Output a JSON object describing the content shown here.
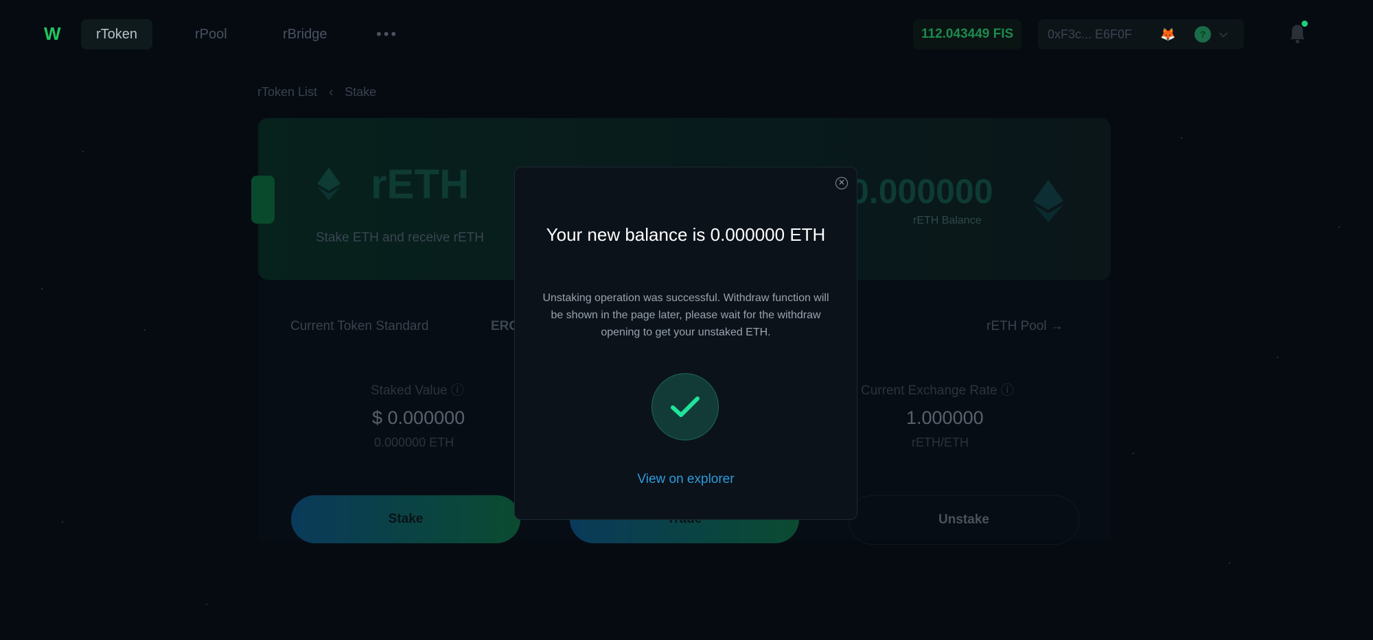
{
  "nav": {
    "tabs": [
      {
        "label": "rToken"
      },
      {
        "label": "rPool"
      },
      {
        "label": "rBridge"
      }
    ],
    "more": "•••",
    "fis_balance": "112.043449 FIS",
    "address": "0xF3c... E6F0F"
  },
  "page": {
    "breadcrumb": {
      "root": "rToken List",
      "sep": "‹",
      "current": "Stake"
    },
    "hero": {
      "title": "rETH",
      "subtitle": "Stake ETH and receive rETH",
      "balance": "0.000000",
      "balance_label": "rETH Balance"
    },
    "token_standard_label": "Current Token Standard",
    "token_standard_value": "ERC",
    "pool_link": "rETH Pool",
    "stats": {
      "staked_label": "Staked Value",
      "staked_value": "$ 0.000000",
      "staked_sub": "0.000000 ETH",
      "rate_label": "Current Exchange Rate",
      "rate_value": "1.000000",
      "rate_sub": "rETH/ETH"
    },
    "buttons": {
      "stake": "Stake",
      "trade": "Trade",
      "unstake": "Unstake"
    }
  },
  "modal": {
    "title": "Your new balance is 0.000000 ETH",
    "message": "Unstaking operation was successful. Withdraw function will be shown in the page later, please wait for the withdraw opening to get your unstaked ETH.",
    "link": "View on explorer",
    "close_icon": "close-circle-icon",
    "status_icon": "checkmark-icon"
  },
  "colors": {
    "accent": "#2d9cdb",
    "success": "#1fd07a",
    "background": "#060b12"
  }
}
